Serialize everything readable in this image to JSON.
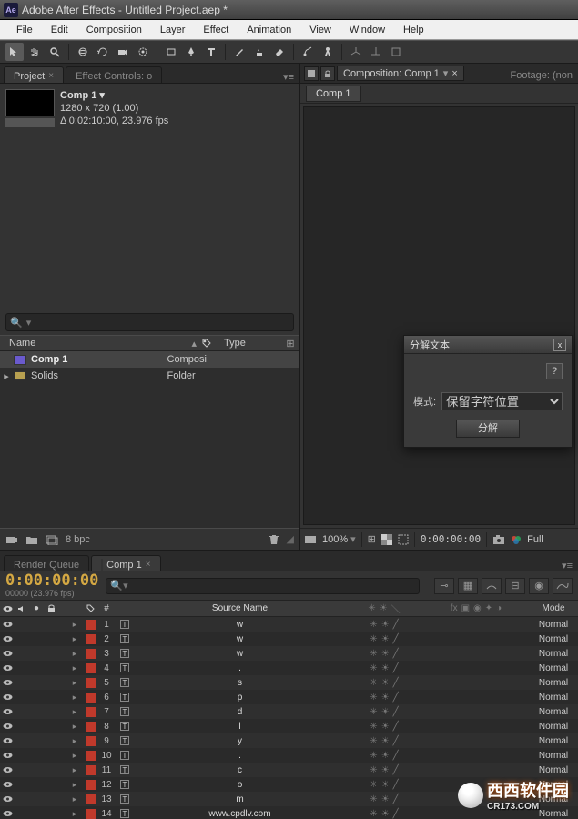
{
  "title_bar": {
    "app_prefix": "Ae",
    "text": "Adobe After Effects - Untitled Project.aep *"
  },
  "menu": [
    "File",
    "Edit",
    "Composition",
    "Layer",
    "Effect",
    "Animation",
    "View",
    "Window",
    "Help"
  ],
  "project_panel": {
    "tab_project": "Project",
    "tab_effect_controls": "Effect Controls: o",
    "comp_name": "Comp 1 ▾",
    "dims": "1280 x 720 (1.00)",
    "duration": "Δ 0:02:10:00, 23.976 fps",
    "search_placeholder": "",
    "col_name": "Name",
    "col_type": "Type",
    "items": [
      {
        "name": "Comp 1",
        "type": "Composi",
        "icon": "comp",
        "swatch": "#8a7a56",
        "selected": true,
        "expandable": false
      },
      {
        "name": "Solids",
        "type": "Folder",
        "icon": "folder",
        "swatch": "#d6c33a",
        "selected": false,
        "expandable": true
      }
    ],
    "bpc": "8 bpc"
  },
  "composition_panel": {
    "tab_label": "Composition: Comp 1",
    "footage_label": "Footage: (non",
    "breadcrumb": "Comp 1",
    "zoom": "100%",
    "time": "0:00:00:00",
    "quality": "Full"
  },
  "dialog": {
    "title": "分解文本",
    "help": "?",
    "mode_label": "模式:",
    "mode_value": "保留字符位置",
    "run": "分解"
  },
  "timeline": {
    "tab_renderq": "Render Queue",
    "tab_comp": "Comp 1",
    "timecode": "0:00:00:00",
    "timecode_sub": "00000 (23.976 fps)",
    "col_num": "#",
    "col_source": "Source Name",
    "col_mode": "Mode",
    "layers": [
      {
        "n": 1,
        "name": "w"
      },
      {
        "n": 2,
        "name": "w"
      },
      {
        "n": 3,
        "name": "w"
      },
      {
        "n": 4,
        "name": "."
      },
      {
        "n": 5,
        "name": "s"
      },
      {
        "n": 6,
        "name": "p"
      },
      {
        "n": 7,
        "name": "d"
      },
      {
        "n": 8,
        "name": "l"
      },
      {
        "n": 9,
        "name": "y"
      },
      {
        "n": 10,
        "name": "."
      },
      {
        "n": 11,
        "name": "c"
      },
      {
        "n": 12,
        "name": "o"
      },
      {
        "n": 13,
        "name": "m"
      },
      {
        "n": 14,
        "name": "www.cpdlv.com"
      }
    ],
    "mode_value": "Normal"
  },
  "watermark": {
    "main": "西西软件园",
    "sub": "CR173.COM"
  }
}
